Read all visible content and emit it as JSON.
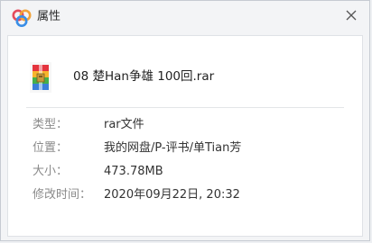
{
  "window": {
    "title": "属性",
    "close_icon": "close-icon",
    "app_icon": "cloud-app-logo"
  },
  "file": {
    "icon": "rar-archive-icon",
    "name": "08 楚Han争雄 100回.rar"
  },
  "properties": [
    {
      "label": "类型：",
      "value": "rar文件"
    },
    {
      "label": "位置：",
      "value": "我的网盘/P-评书/单Tian芳"
    },
    {
      "label": "大小：",
      "value": "473.78MB"
    },
    {
      "label": "修改时间：",
      "value": "2020年09月22日, 20:32"
    }
  ],
  "colors": {
    "background": "#f3f4f6",
    "card": "#ffffff",
    "label": "#8a8a8a",
    "value": "#333333"
  }
}
